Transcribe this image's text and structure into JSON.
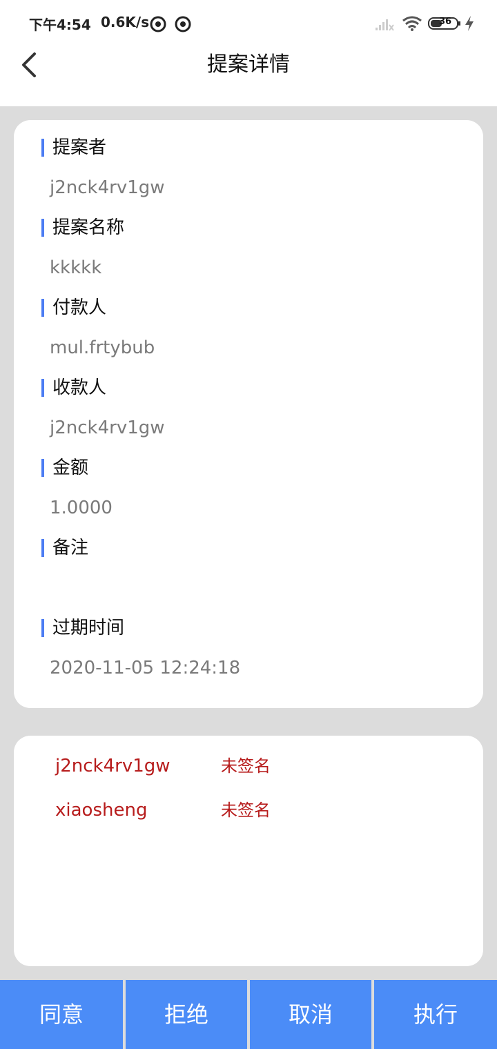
{
  "status_bar": {
    "time": "下午4:54",
    "speed": "0.6K/s",
    "battery": "36"
  },
  "header": {
    "title": "提案详情"
  },
  "details": {
    "proposer_label": "提案者",
    "proposer_value": "j2nck4rv1gw",
    "name_label": "提案名称",
    "name_value": "kkkkk",
    "payer_label": "付款人",
    "payer_value": "mul.frtybub",
    "payee_label": "收款人",
    "payee_value": "j2nck4rv1gw",
    "amount_label": "金额",
    "amount_value": "1.0000",
    "note_label": "备注",
    "note_value": "",
    "expire_label": "过期时间",
    "expire_value": "2020-11-05 12:24:18"
  },
  "signatures": [
    {
      "name": "j2nck4rv1gw",
      "status": "未签名"
    },
    {
      "name": "xiaosheng",
      "status": "未签名"
    }
  ],
  "actions": {
    "agree": "同意",
    "reject": "拒绝",
    "cancel": "取消",
    "execute": "执行"
  },
  "colors": {
    "accent": "#4b8cf7",
    "label_bar": "#4b7cf3",
    "unsigned": "#b71c1c",
    "page_bg": "#dcdcdc"
  }
}
